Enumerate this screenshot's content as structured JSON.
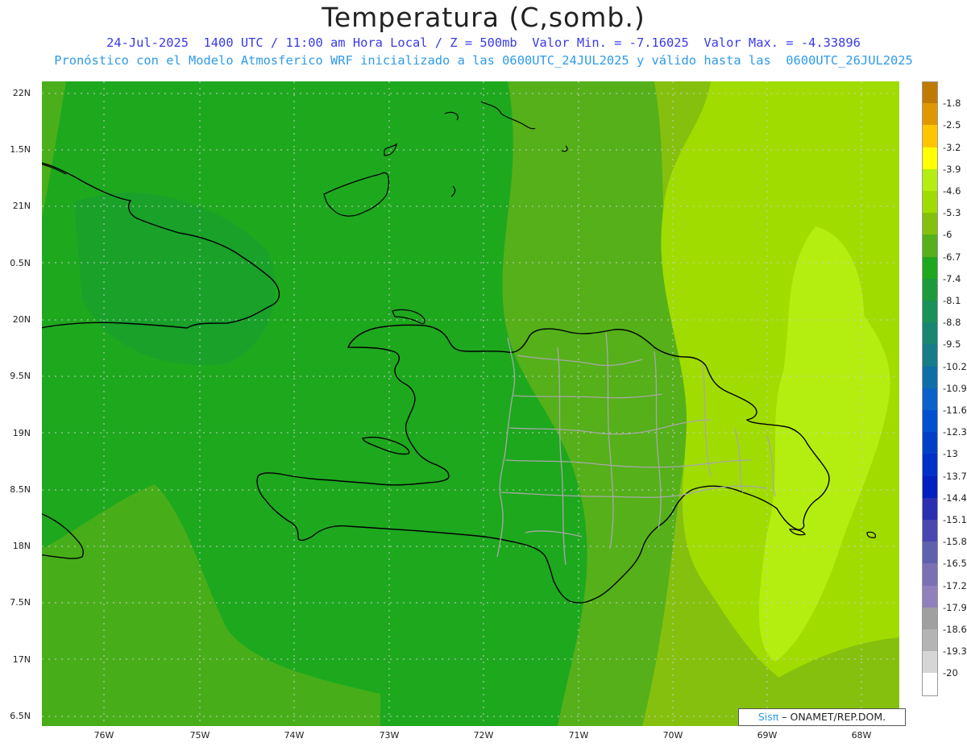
{
  "header": {
    "title": "Temperatura (C,somb.)",
    "line1": "24-Jul-2025  1400 UTC / 11:00 am Hora Local / Z = 500mb  Valor Min. = -7.16025  Valor Max. = -4.33896",
    "line2": "Pronóstico con el Modelo Atmosferico WRF inicializado a las 0600UTC_24JUL2025 y válido hasta las  0600UTC_26JUL2025"
  },
  "map": {
    "lat_labels": [
      "22N",
      "1.5N",
      "21N",
      "0.5N",
      "20N",
      "9.5N",
      "19N",
      "8.5N",
      "18N",
      "7.5N",
      "17N",
      "6.5N"
    ],
    "lon_labels": [
      "76W",
      "75W",
      "74W",
      "73W",
      "72W",
      "71W",
      "70W",
      "69W",
      "68W"
    ],
    "lon_range": [
      -76.65,
      -67.6
    ],
    "lat_range": [
      16.45,
      22.15
    ],
    "colors": {
      "base": "#1ea81e",
      "dark": "#16a016",
      "mid": "#55b01a",
      "olive": "#86c00e",
      "light": "#a0dc00",
      "lightest": "#b4ee10",
      "coast": "#000000",
      "provinces": "#a8a8a8",
      "grid": "#cccccc"
    }
  },
  "colorbar": {
    "labels": [
      "-1.8",
      "-2.5",
      "-3.2",
      "-3.9",
      "-4.6",
      "-5.3",
      "-6",
      "-6.7",
      "-7.4",
      "-8.1",
      "-8.8",
      "-9.5",
      "-10.2",
      "-10.9",
      "-11.6",
      "-12.3",
      "-13",
      "-13.7",
      "-14.4",
      "-15.1",
      "-15.8",
      "-16.5",
      "-17.2",
      "-17.9",
      "-18.6",
      "-19.3",
      "-20"
    ],
    "colors": [
      "#c07a00",
      "#e09800",
      "#ffc600",
      "#ffff00",
      "#b4ee10",
      "#a0dc00",
      "#86c00e",
      "#55b01a",
      "#1ea81e",
      "#1c9a3c",
      "#1a905a",
      "#188670",
      "#157c88",
      "#0f6ea8",
      "#0a62c8",
      "#0050d0",
      "#0040c8",
      "#0030c8",
      "#0020c0",
      "#2a30b0",
      "#4848b0",
      "#6060b0",
      "#7a70b4",
      "#9080bc",
      "#a0a0a0",
      "#b4b4b4",
      "#d6d6d6",
      "#ffffff"
    ]
  },
  "credit": {
    "brand": "Sisπ",
    "text": " – ONAMET/REP.DOM."
  }
}
